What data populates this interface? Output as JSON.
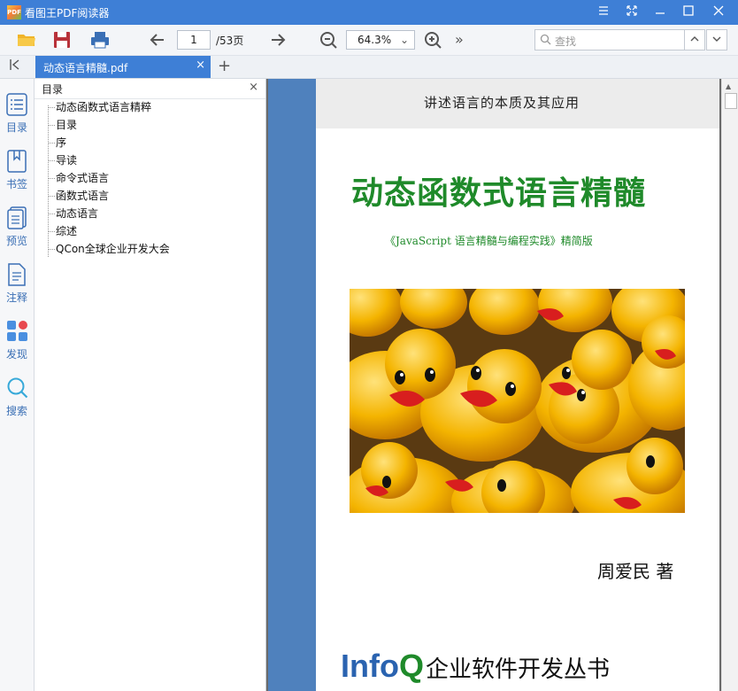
{
  "app": {
    "title": "看图王PDF阅读器",
    "logo_text": "PDF"
  },
  "toolbar": {
    "page_current": "1",
    "page_total": "/53页",
    "zoom": "64.3%",
    "search_placeholder": "查找",
    "more": "»"
  },
  "tab": {
    "label": "动态语言精髓.pdf",
    "close": "×",
    "add": "+"
  },
  "rail": {
    "items": [
      {
        "label": "目录",
        "icon": "list-icon"
      },
      {
        "label": "书签",
        "icon": "bookmark-icon"
      },
      {
        "label": "预览",
        "icon": "preview-icon"
      },
      {
        "label": "注释",
        "icon": "note-icon"
      },
      {
        "label": "发现",
        "icon": "discover-icon"
      },
      {
        "label": "搜索",
        "icon": "search-icon"
      }
    ]
  },
  "toc": {
    "title": "目录",
    "close": "×",
    "items": [
      "动态函数式语言精粹",
      "目录",
      "序",
      "导读",
      "命令式语言",
      "函数式语言",
      "动态语言",
      "综述",
      "QCon全球企业开发大会"
    ]
  },
  "page": {
    "header": "讲述语言的本质及其应用",
    "title": "动态函数式语言精髓",
    "subtitle": "《JavaScript 语言精髓与编程实践》精简版",
    "author": "周爱民 著",
    "publisher_logo_a": "Info",
    "publisher_logo_b": "Q",
    "publisher_text": "企业软件开发丛书"
  },
  "colors": {
    "accent": "#3e7fd6",
    "page_stripe": "#4f81bd",
    "title_green": "#1f8a2a"
  }
}
